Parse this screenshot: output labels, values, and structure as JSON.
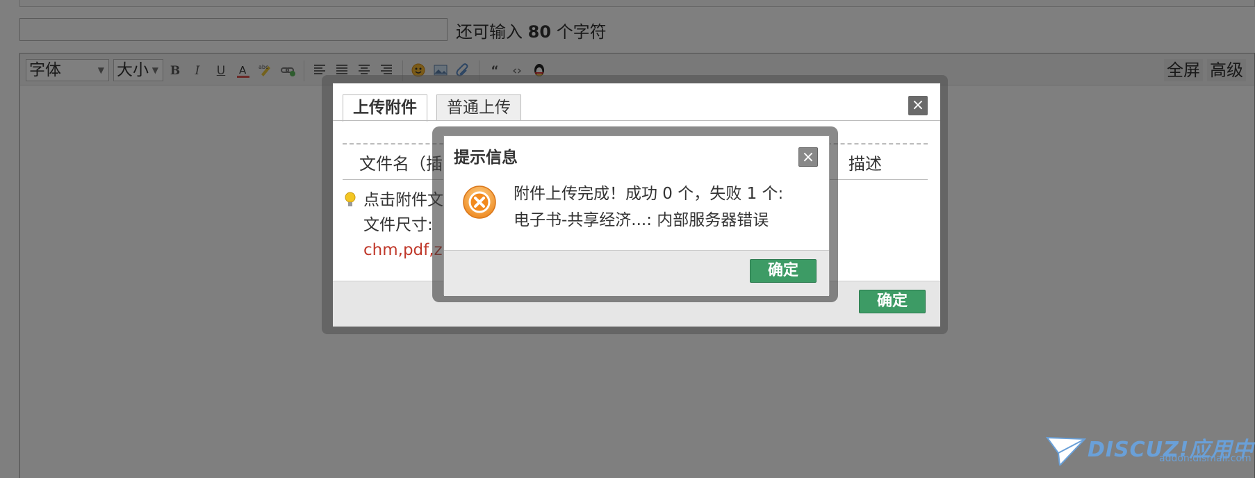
{
  "editor": {
    "char_hint_prefix": "还可输入",
    "char_hint_count": "80",
    "char_hint_suffix": "个字符",
    "toolbar": {
      "font_select": "字体",
      "size_select": "大小",
      "bold_label": "B",
      "italic_label": "I",
      "underline_label": "U",
      "fullscreen_label": "全屏",
      "advanced_label": "高级"
    }
  },
  "upload_dialog": {
    "tabs": [
      {
        "label": "上传附件",
        "active": true
      },
      {
        "label": "普通上传",
        "active": false
      }
    ],
    "close_label": "×",
    "columns": {
      "filename": "文件名（插",
      "description": "描述"
    },
    "tip_line1": "点击附件文",
    "tip_line2": "文件尺寸: ",
    "tip_line3": "chm,pdf,zip",
    "confirm_label": "确定"
  },
  "alert_dialog": {
    "title": "提示信息",
    "close_label": "×",
    "message_line1": "附件上传完成！成功 0 个，失败 1 个:",
    "message_line2": "电子书-共享经济...: 内部服务器错误",
    "confirm_label": "确定"
  },
  "watermark": {
    "brand": "DISCUZ!应用中心",
    "url": "addon.dismall.com"
  },
  "colors": {
    "confirm_button": "#3d9b65",
    "error_icon": "#f0902a",
    "overlay": "rgba(0,0,0,0.5)",
    "file_types_text": "#c0392b"
  }
}
